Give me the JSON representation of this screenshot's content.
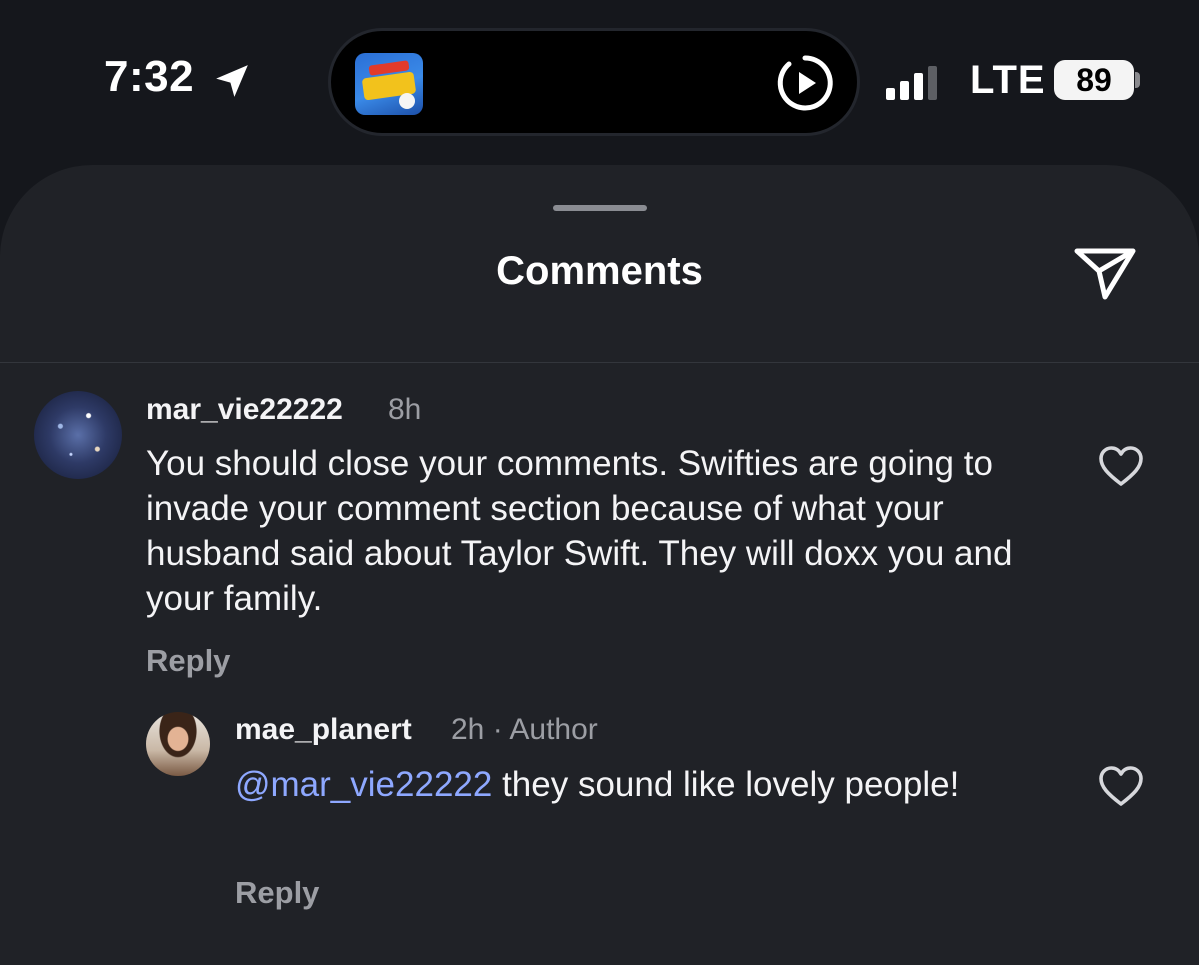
{
  "status_bar": {
    "time": "7:32",
    "network": "LTE",
    "battery": "89",
    "now_playing_icon": "baseball-today-app-art"
  },
  "sheet": {
    "title": "Comments"
  },
  "comments": [
    {
      "username": "mar_vie22222",
      "time": "8h",
      "text": "You should close your comments. Swifties are going to invade your comment section because of what your husband said about Taylor Swift. They will doxx you and your family.",
      "reply_label": "Reply",
      "replies": [
        {
          "username": "mae_planert",
          "meta": "2h · Author",
          "mention": "@mar_vie22222",
          "text": " they sound like lovely people!",
          "reply_label": "Reply"
        }
      ]
    }
  ],
  "colors": {
    "background": "#15171c",
    "sheet": "#202227",
    "text": "#f4f4f6",
    "muted": "#9c9ea4",
    "mention": "#8ea8ff"
  }
}
